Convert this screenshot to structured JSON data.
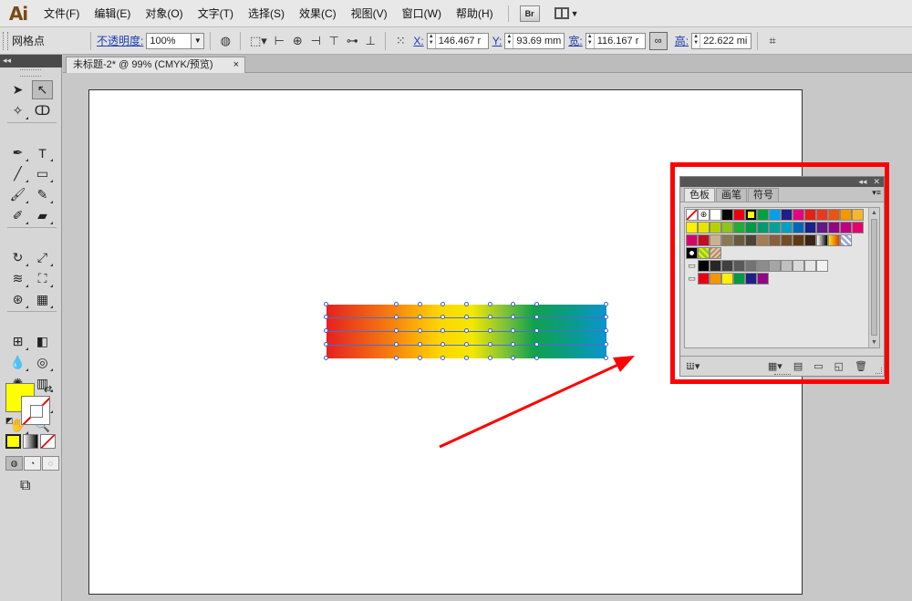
{
  "app": {
    "logo": "Ai"
  },
  "menu": [
    "文件(F)",
    "编辑(E)",
    "对象(O)",
    "文字(T)",
    "选择(S)",
    "效果(C)",
    "视图(V)",
    "窗口(W)",
    "帮助(H)"
  ],
  "menu_extra": {
    "bridge_label": "Br"
  },
  "control_bar": {
    "selection_label": "网格点",
    "opacity_label": "不透明度:",
    "opacity_value": "100%",
    "x_label": "X:",
    "x_value": "146.467 r",
    "y_label": "Y:",
    "y_value": "93.69 mm",
    "w_label": "宽:",
    "w_value": "116.167 r",
    "h_label": "高:",
    "h_value": "22.622 mi"
  },
  "toolbox": {
    "collapse_label": "◂◂"
  },
  "document": {
    "tab_title": "未标题-2* @ 99% (CMYK/预览)",
    "close_symbol": "×"
  },
  "swatches_panel": {
    "tabs": [
      "色板",
      "画笔",
      "符号"
    ],
    "active_tab": "色板",
    "rows": [
      [
        "#ffffff",
        "#ffffff",
        "#ffffff",
        "#000000",
        "#e60012",
        "#ffff00",
        "#00a040",
        "#00a0e9",
        "#1d2088",
        "#e4007f",
        "#e61f19",
        "#e83820",
        "#ea5514",
        "#f39800",
        "#f8b62d"
      ],
      [
        "#fff100",
        "#e8e300",
        "#b5d100",
        "#8fc31f",
        "#22ac38",
        "#009944",
        "#009b6b",
        "#00a29a",
        "#00a0c1",
        "#0068b7",
        "#1d2088",
        "#601986",
        "#920783",
        "#be0081",
        "#e5006a"
      ],
      [
        "#d7006c",
        "#c30d23",
        "#c9b28f",
        "#8c7853",
        "#6b5a3a",
        "#4f4230",
        "#a67c52",
        "#8b5e3c",
        "#754c24",
        "#603913",
        "#3c2415",
        "gradient-bw",
        "gradient-orange",
        "gradient-blue"
      ],
      [
        "pattern-1",
        "pattern-2",
        "pattern-3"
      ],
      [
        "folder",
        "#000000",
        "#262626",
        "#404040",
        "#595959",
        "#737373",
        "#8c8c8c",
        "#a6a6a6",
        "#bfbfbf",
        "#d9d9d9",
        "#e6e6e6",
        "#f2f2f2"
      ],
      [
        "folder",
        "#e60012",
        "#f39800",
        "#fff100",
        "#009944",
        "#1d2088",
        "#920783"
      ]
    ]
  },
  "accent": {
    "annotation": "#ff0000",
    "selection": "#3a5fcd",
    "fill_color": "#ffff00"
  }
}
